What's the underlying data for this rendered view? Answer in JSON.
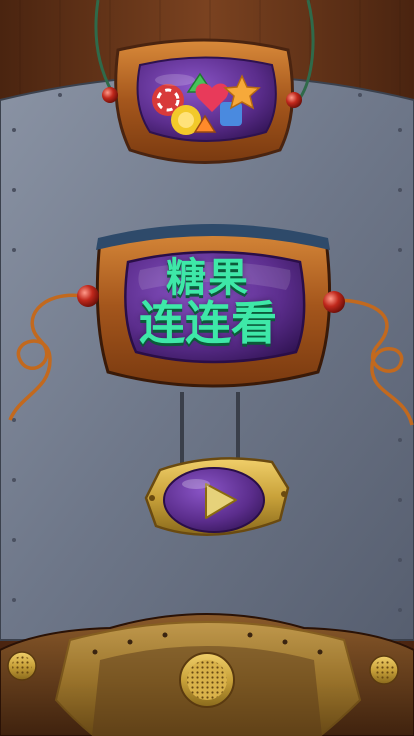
{
  "title": {
    "line1": "糖果",
    "line2": "连连看"
  },
  "play_button": {
    "icon": "play-icon"
  },
  "colors": {
    "background_brown": "#6b3a1c",
    "metal_panel": "#7c8596",
    "copper_frame": "#b5651d",
    "screen_purple": "#5b2d8c",
    "title_green": "#3ee8a8",
    "brass": "#c9a23a"
  }
}
